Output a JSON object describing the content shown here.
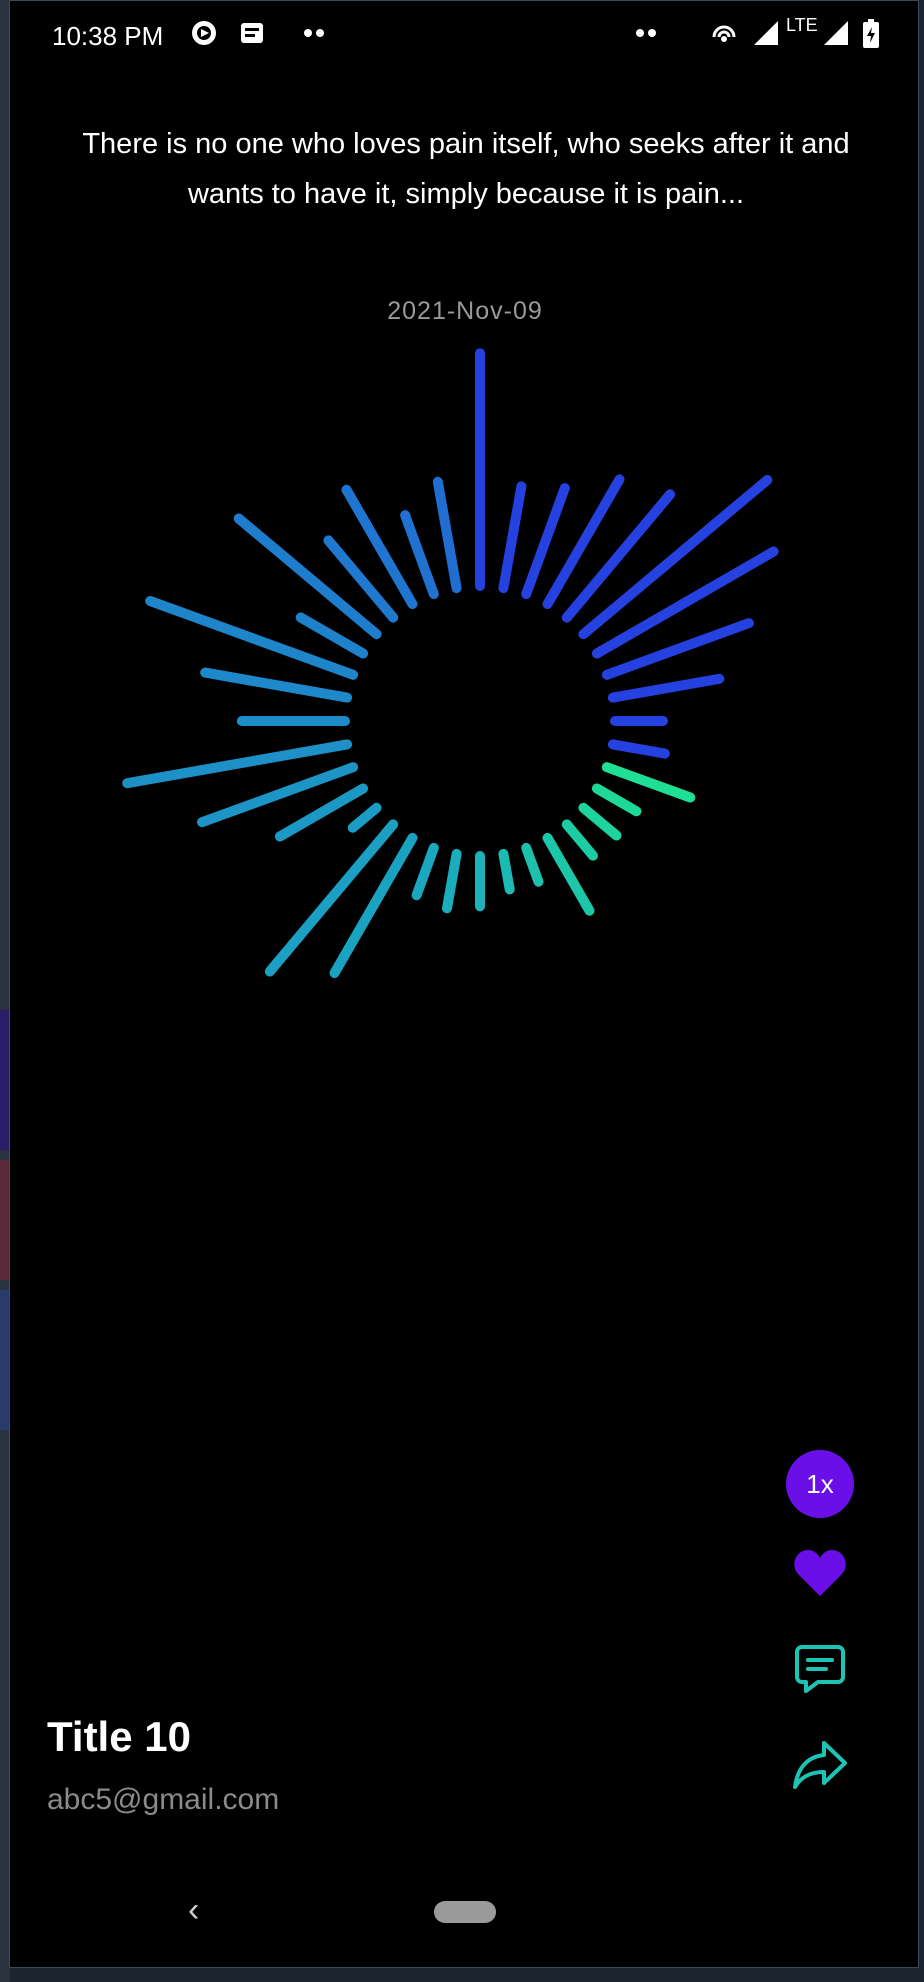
{
  "status_bar": {
    "time": "10:38 PM",
    "left_icons": [
      "cast-icon",
      "news-icon",
      "more-dots-icon"
    ],
    "right_icons": [
      "more-dots-icon",
      "hotspot-icon",
      "signal-icon",
      "network-type",
      "signal-icon",
      "battery-icon"
    ],
    "network_type": "LTE"
  },
  "post": {
    "quote": "There is no one who loves pain itself, who seeks after it and wants to have it, simply because it is pain...",
    "date": "2021-Nov-09",
    "title": "Title 10",
    "author_email": "abc5@gmail.com"
  },
  "actions": {
    "speed_label": "1x",
    "icons": [
      "heart-icon",
      "comment-icon",
      "share-icon"
    ]
  },
  "colors": {
    "accent_purple": "#6a0fe8",
    "icon_teal": "#1dc4b5",
    "viz_blue": "#2541e0",
    "viz_green": "#1ee58f",
    "viz_cyan": "#1aa8c0"
  },
  "visualizer": {
    "description_free": true,
    "bar_levels": [
      0.92,
      0.38,
      0.42,
      0.55,
      0.62,
      0.95,
      0.8,
      0.58,
      0.4,
      0.15,
      0.17,
      0.32,
      0.14,
      0.13,
      0.12,
      0.3,
      0.1,
      0.1,
      0.16,
      0.18,
      0.16,
      0.6,
      0.75,
      0.08,
      0.35,
      0.62,
      0.88,
      0.38,
      0.55,
      0.85,
      0.25,
      0.7,
      0.37,
      0.5,
      0.3,
      0.4
    ]
  }
}
